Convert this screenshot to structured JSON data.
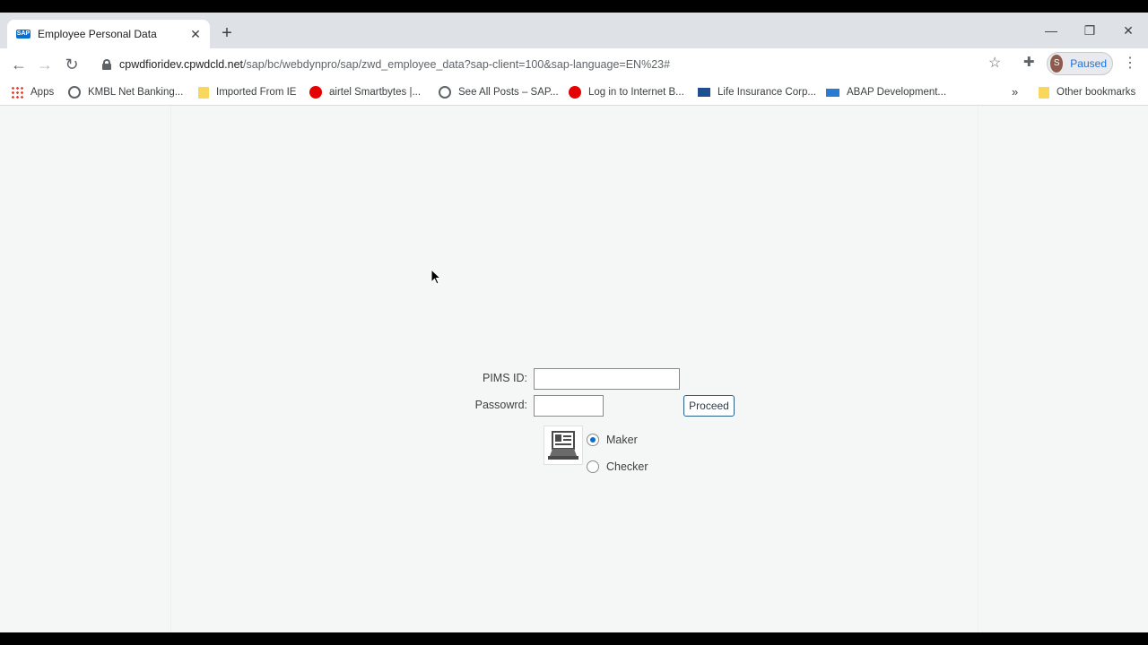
{
  "browser": {
    "tab_title": "Employee Personal Data",
    "url_host": "cpwdfioridev.cpwdcld.net",
    "url_path": "/sap/bc/webdynpro/sap/zwd_employee_data?sap-client=100&sap-language=EN%23#",
    "profile_initial": "S",
    "profile_status": "Paused"
  },
  "bookmarks": [
    {
      "label": "Apps",
      "icon": "apps-grid-icon"
    },
    {
      "label": "KMBL Net Banking...",
      "icon": "globe-icon"
    },
    {
      "label": "Imported From IE",
      "icon": "folder-icon"
    },
    {
      "label": "airtel Smartbytes |...",
      "icon": "airtel-icon"
    },
    {
      "label": "See All Posts – SAP...",
      "icon": "globe-icon"
    },
    {
      "label": "Log in to Internet B...",
      "icon": "airtel-icon"
    },
    {
      "label": "Life Insurance Corp...",
      "icon": "lic-icon"
    },
    {
      "label": "ABAP Development...",
      "icon": "sap-icon"
    }
  ],
  "other_bookmarks": "Other bookmarks",
  "form": {
    "pims_label": "PIMS ID:",
    "pims_value": "",
    "password_label": "Passowrd:",
    "password_value": "",
    "proceed_label": "Proceed",
    "roles": [
      {
        "label": "Maker",
        "selected": true
      },
      {
        "label": "Checker",
        "selected": false
      }
    ]
  },
  "colors": {
    "accent": "#0a6ed1",
    "page_bg": "#f5f6f6"
  }
}
